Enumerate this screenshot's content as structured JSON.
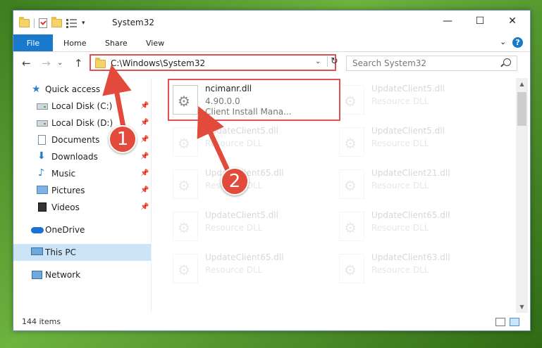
{
  "window": {
    "title": "System32",
    "minimize_glyph": "—",
    "maximize_glyph": "☐",
    "close_glyph": "✕"
  },
  "ribbon": {
    "tabs": [
      "File",
      "Home",
      "Share",
      "View"
    ],
    "collapse_glyph": "⌄",
    "help_glyph": "?"
  },
  "address": {
    "path": "C:\\Windows\\System32",
    "dropdown_glyph": "⌄",
    "refresh_glyph": "↻"
  },
  "nav": {
    "back_glyph": "←",
    "forward_glyph": "→",
    "recent_glyph": "⌄",
    "up_glyph": "↑"
  },
  "search": {
    "placeholder": "Search System32"
  },
  "sidebar": {
    "items": [
      {
        "label": "Quick access",
        "icon": "star-icon"
      },
      {
        "label": "Local Disk (C:)",
        "icon": "disk-icon",
        "pinned": true
      },
      {
        "label": "Local Disk (D:)",
        "icon": "disk-icon",
        "pinned": true
      },
      {
        "label": "Documents",
        "icon": "documents-icon",
        "pinned": true
      },
      {
        "label": "Downloads",
        "icon": "downloads-icon",
        "pinned": true
      },
      {
        "label": "Music",
        "icon": "music-icon",
        "pinned": true
      },
      {
        "label": "Pictures",
        "icon": "pictures-icon",
        "pinned": true
      },
      {
        "label": "Videos",
        "icon": "videos-icon",
        "pinned": true
      },
      {
        "label": "OneDrive",
        "icon": "onedrive-icon"
      },
      {
        "label": "This PC",
        "icon": "this-pc-icon",
        "selected": true
      },
      {
        "label": "Network",
        "icon": "network-icon"
      }
    ],
    "pin_glyph": "📌"
  },
  "files": [
    {
      "name": "ncimanr.dll",
      "line2": "4.90.0.0",
      "line3": "Client Install Mana...",
      "highlighted": true
    },
    {
      "name": "UpdateClient5.dll",
      "line2": "Resource DLL",
      "faded": true
    },
    {
      "name": "UpdateClient5.dll",
      "line2": "Resource DLL",
      "faded": true
    },
    {
      "name": "UpdateClient5.dll",
      "line2": "Resource DLL",
      "faded": true
    },
    {
      "name": "UpdateClient65.dll",
      "line2": "Resource DLL",
      "faded": true
    },
    {
      "name": "UpdateClient21.dll",
      "line2": "Resource DLL",
      "faded": true
    },
    {
      "name": "UpdateClient5.dll",
      "line2": "Resource DLL",
      "faded": true
    },
    {
      "name": "UpdateClient65.dll",
      "line2": "Resource DLL",
      "faded": true
    },
    {
      "name": "UpdateClient65.dll",
      "line2": "Resource DLL",
      "faded": true
    },
    {
      "name": "UpdateClient63.dll",
      "line2": "Resource DLL",
      "faded": true
    }
  ],
  "status": {
    "item_count": "144 items"
  },
  "annotations": {
    "step1": "1",
    "step2": "2",
    "color": "#e24a3b"
  },
  "scrollbar": {
    "up_glyph": "▲",
    "down_glyph": "▼"
  }
}
